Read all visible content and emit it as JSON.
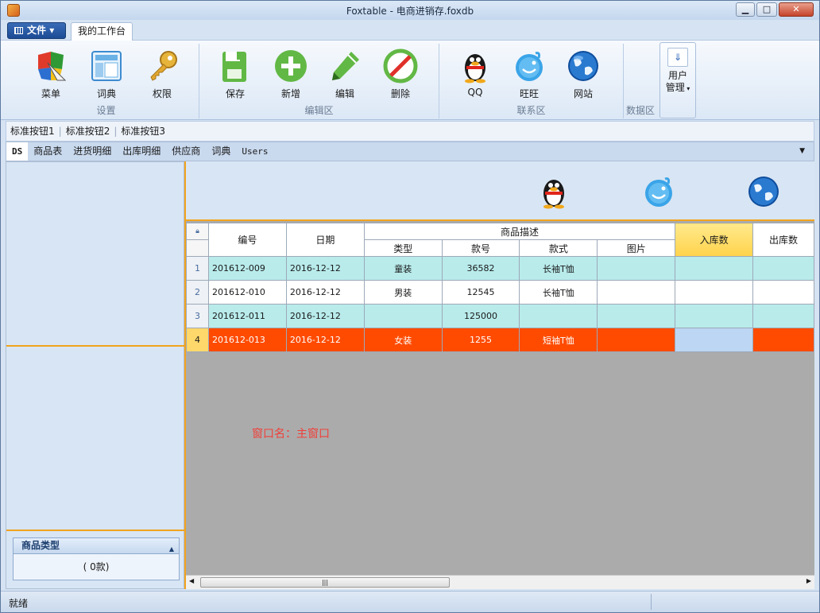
{
  "window": {
    "title": "Foxtable - 电商进销存.foxdb",
    "min": "▁",
    "max": "□",
    "close": "✕"
  },
  "menubar": {
    "file_label": "文件",
    "home_tab": "我的工作台"
  },
  "ribbon": {
    "groups": [
      {
        "label": "设置",
        "buttons": [
          {
            "label": "菜单",
            "icon": "menu-icon"
          },
          {
            "label": "词典",
            "icon": "dictionary-icon"
          },
          {
            "label": "权限",
            "icon": "key-icon"
          }
        ]
      },
      {
        "label": "编辑区",
        "buttons": [
          {
            "label": "保存",
            "icon": "save-icon"
          },
          {
            "label": "新增",
            "icon": "add-icon"
          },
          {
            "label": "编辑",
            "icon": "pencil-icon"
          },
          {
            "label": "删除",
            "icon": "delete-icon"
          }
        ]
      },
      {
        "label": "联系区",
        "buttons": [
          {
            "label": "QQ",
            "icon": "qq-penguin-icon"
          },
          {
            "label": "旺旺",
            "icon": "wangwang-icon"
          },
          {
            "label": "网站",
            "icon": "globe-icon"
          }
        ]
      },
      {
        "label": "数据区",
        "buttons": []
      }
    ],
    "user_mgmt": {
      "line1": "用户",
      "line2": "管理"
    }
  },
  "quickbar": [
    "标准按钮1",
    "标准按钮2",
    "标准按钮3"
  ],
  "tabs": [
    "DS",
    "商品表",
    "进货明细",
    "出库明细",
    "供应商",
    "词典",
    "Users"
  ],
  "left": {
    "type_panel_title": "商品类型",
    "type_panel_value": "( 0款)"
  },
  "grid": {
    "headers": {
      "id": "编号",
      "date": "日期",
      "desc": "商品描述",
      "type": "类型",
      "code": "款号",
      "style": "款式",
      "image": "图片",
      "in_qty": "入库数",
      "out_qty": "出库数"
    },
    "rows": [
      {
        "n": "1",
        "id": "201612-009",
        "date": "2016-12-12",
        "type": "童装",
        "code": "36582",
        "style": "长袖T恤",
        "image": "",
        "in_qty": "",
        "out_qty": ""
      },
      {
        "n": "2",
        "id": "201612-010",
        "date": "2016-12-12",
        "type": "男装",
        "code": "12545",
        "style": "长袖T恤",
        "image": "",
        "in_qty": "",
        "out_qty": ""
      },
      {
        "n": "3",
        "id": "201612-011",
        "date": "2016-12-12",
        "type": "",
        "code": "125000",
        "style": "",
        "image": "",
        "in_qty": "",
        "out_qty": ""
      },
      {
        "n": "4",
        "id": "201612-013",
        "date": "2016-12-12",
        "type": "女装",
        "code": "1255",
        "style": "短袖T恤",
        "image": "",
        "in_qty": "",
        "out_qty": ""
      }
    ]
  },
  "window_name": "窗口名：主窗口",
  "status": "就绪"
}
